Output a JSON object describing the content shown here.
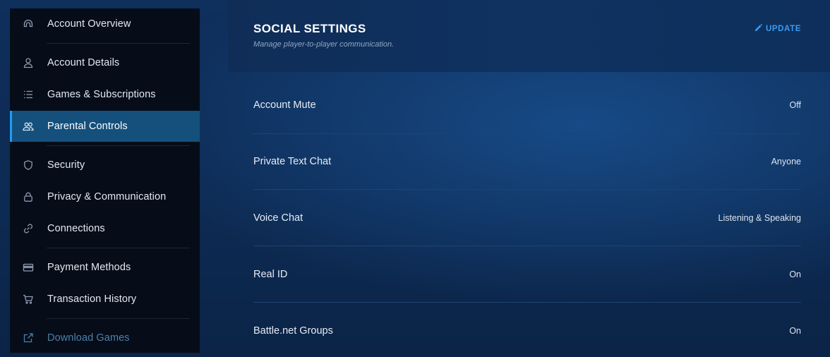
{
  "sidebar": {
    "items": [
      {
        "label": "Account Overview",
        "icon": "home-icon"
      },
      {
        "label": "Account Details",
        "icon": "user-icon"
      },
      {
        "label": "Games & Subscriptions",
        "icon": "list-icon"
      },
      {
        "label": "Parental Controls",
        "icon": "users-icon",
        "active": true
      },
      {
        "label": "Security",
        "icon": "shield-icon"
      },
      {
        "label": "Privacy & Communication",
        "icon": "lock-icon"
      },
      {
        "label": "Connections",
        "icon": "link-icon"
      },
      {
        "label": "Payment Methods",
        "icon": "credit-card-icon"
      },
      {
        "label": "Transaction History",
        "icon": "cart-icon"
      },
      {
        "label": "Download Games",
        "icon": "external-link-icon"
      }
    ]
  },
  "panel": {
    "title": "SOCIAL SETTINGS",
    "subtitle": "Manage player-to-player communication.",
    "update_label": "UPDATE",
    "rows": [
      {
        "label": "Account Mute",
        "value": "Off"
      },
      {
        "label": "Private Text Chat",
        "value": "Anyone"
      },
      {
        "label": "Voice Chat",
        "value": "Listening & Speaking"
      },
      {
        "label": "Real ID",
        "value": "On"
      },
      {
        "label": "Battle.net Groups",
        "value": "On"
      }
    ]
  },
  "colors": {
    "accent": "#1f9df2",
    "sidebar_bg": "#060d18",
    "active_bg": "#15507c",
    "panel_bg": "#0d2a52"
  }
}
